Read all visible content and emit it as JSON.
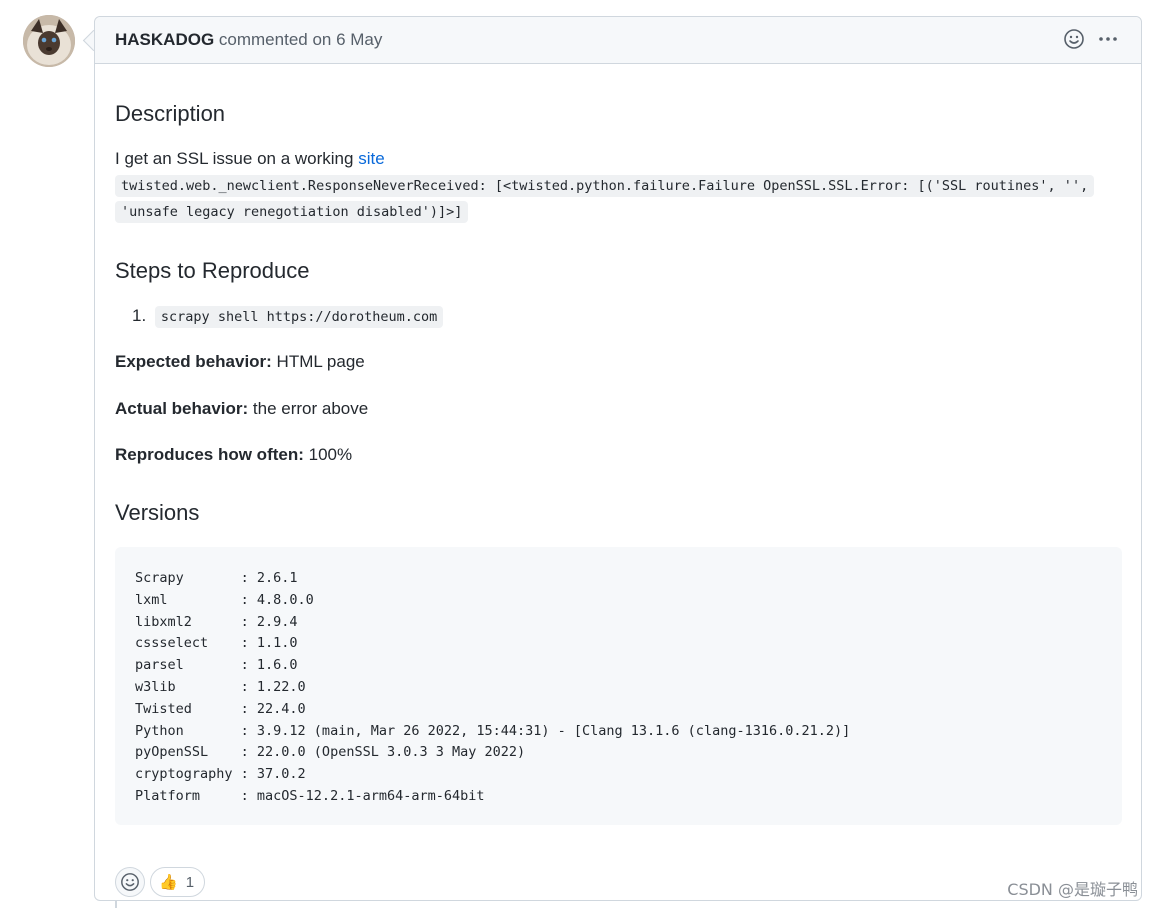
{
  "comment": {
    "author": "HASKADOG",
    "meta": "commented on 6 May",
    "header_icons": [
      "smiley-icon",
      "kebab-menu-icon"
    ]
  },
  "description": {
    "heading": "Description",
    "text": "I get an SSL issue on a working ",
    "link_text": "site",
    "error_line1": "twisted.web._newclient.ResponseNeverReceived: [<twisted.python.failure.Failure OpenSSL.SSL.Error: [('SSL routines', '',",
    "error_line2": "'unsafe legacy renegotiation disabled')]>]"
  },
  "steps": {
    "heading": "Steps to Reproduce",
    "items": [
      {
        "number": "1.",
        "code": "scrapy shell https://dorotheum.com"
      }
    ]
  },
  "behavior": {
    "expected_label": "Expected behavior:",
    "expected_value": " HTML page",
    "actual_label": "Actual behavior:",
    "actual_value": " the error above",
    "often_label": "Reproduces how often:",
    "often_value": " 100%"
  },
  "versions": {
    "heading": "Versions",
    "lines": [
      "Scrapy       : 2.6.1",
      "lxml         : 4.8.0.0",
      "libxml2      : 2.9.4",
      "cssselect    : 1.1.0",
      "parsel       : 1.6.0",
      "w3lib        : 1.22.0",
      "Twisted      : 22.4.0",
      "Python       : 3.9.12 (main, Mar 26 2022, 15:44:31) - [Clang 13.1.6 (clang-1316.0.21.2)]",
      "pyOpenSSL    : 22.0.0 (OpenSSL 3.0.3 3 May 2022)",
      "cryptography : 37.0.2",
      "Platform     : macOS-12.2.1-arm64-arm-64bit"
    ]
  },
  "reactions": {
    "add_icon": "smiley-icon",
    "items": [
      {
        "icon": "thumbs-up-icon",
        "emoji": "👍",
        "count": "1"
      }
    ]
  },
  "watermark": "CSDN @是璇子鸭"
}
